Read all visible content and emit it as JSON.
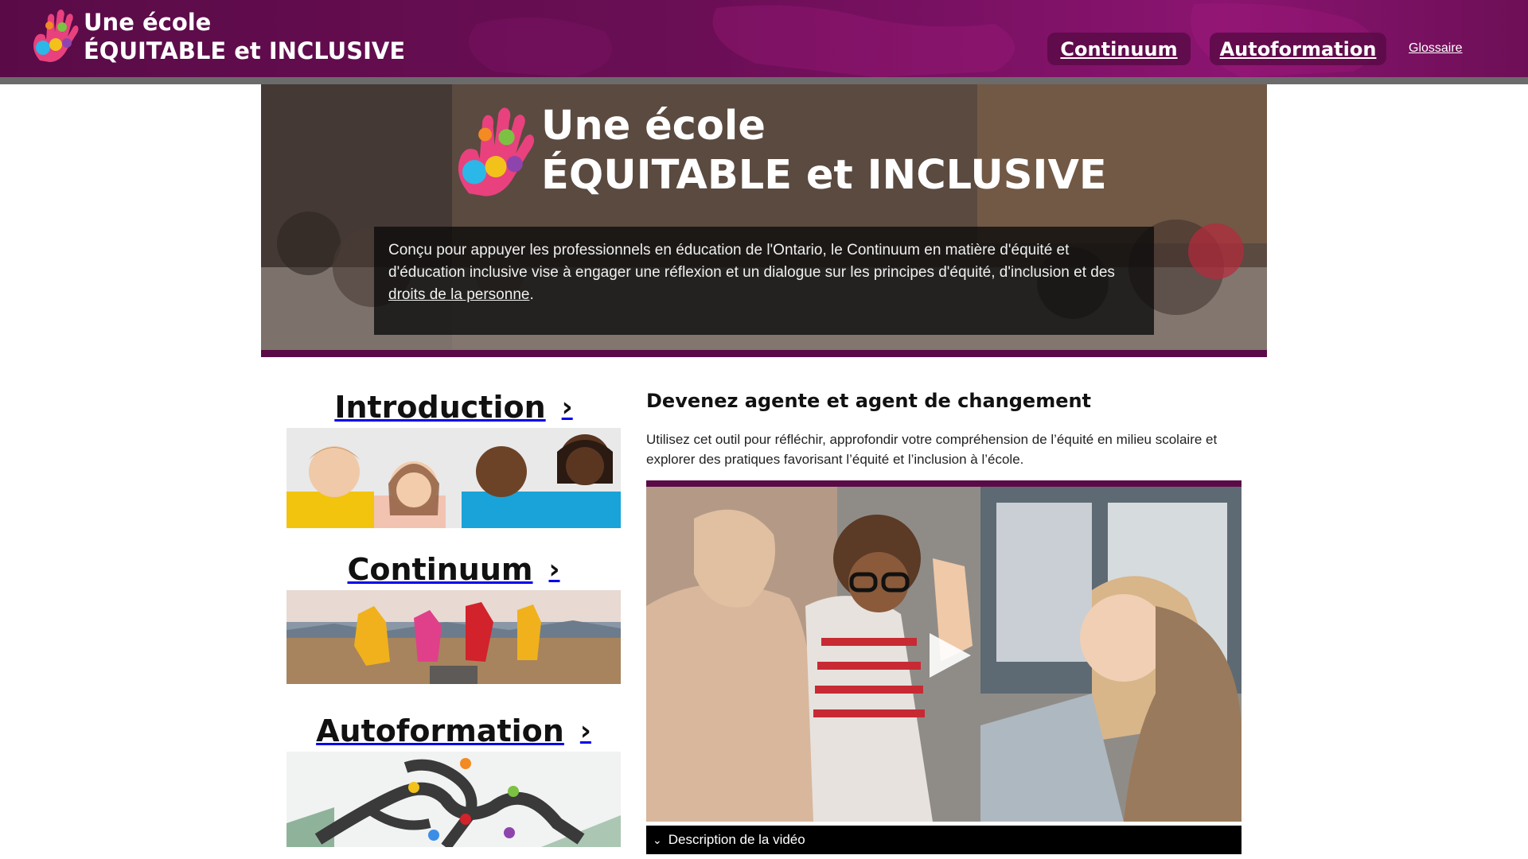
{
  "header": {
    "logo_line1": "Une école",
    "logo_line2": "ÉQUITABLE et INCLUSIVE",
    "nav": {
      "continuum": "Continuum",
      "autoformation": "Autoformation",
      "glossaire": "Glossaire"
    },
    "brand_color": "#6a0e55"
  },
  "hero": {
    "title_line1": "Une école",
    "title_line2": "ÉQUITABLE et INCLUSIVE",
    "description_before_link": "Conçu pour appuyer les professionnels en éducation de l'Ontario, le Continuum en matière d'équité et d'éducation inclusive vise à engager une réflexion et un dialogue sur les principes d'équité, d'inclusion et des ",
    "description_link": "droits de la personne",
    "description_after_link": "."
  },
  "cards": [
    {
      "title": "Introduction",
      "image": "children-smiling-photo",
      "icon": "chevron-right-icon"
    },
    {
      "title": "Continuum",
      "image": "people-jumping-landscape-photo",
      "icon": "chevron-right-icon"
    },
    {
      "title": "Autoformation",
      "image": "road-map-pins-illustration",
      "icon": "chevron-right-icon"
    }
  ],
  "main": {
    "heading": "Devenez agente et agent de changement",
    "intro": "Utilisez cet outil pour réfléchir, approfondir votre compréhension de l’équité en milieu scolaire et explorer des pratiques favorisant l’équité et l’inclusion à l’école.",
    "video": {
      "play_icon": "play-icon",
      "description_toggle": "Description de la vidéo",
      "toggle_icon": "chevron-down-icon"
    }
  }
}
